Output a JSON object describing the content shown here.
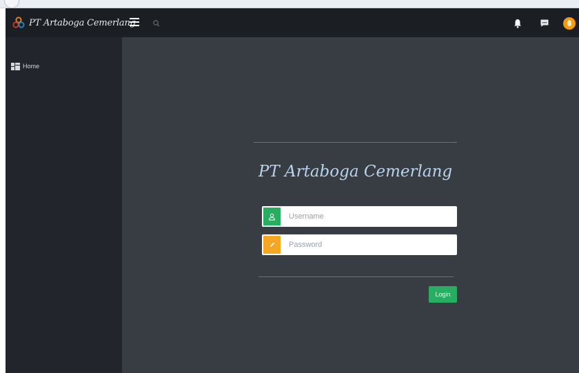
{
  "brand": {
    "name": "PT Artaboga Cemerlang",
    "logo_icon": "brand-logo-icon"
  },
  "topbar": {
    "menu_icon": "hamburger-menu-icon",
    "search_icon": "search-icon",
    "notification_icon": "bell-icon",
    "messages_icon": "chat-icon",
    "avatar_icon": "user-avatar-icon"
  },
  "sidebar": {
    "items": [
      {
        "label": "Home",
        "icon": "dashboard-grid-icon"
      }
    ]
  },
  "login": {
    "title": "PT Artaboga Cemerlang",
    "username": {
      "value": "",
      "placeholder": "Username",
      "icon": "user-icon"
    },
    "password": {
      "value": "",
      "placeholder": "Password",
      "icon": "pencil-icon"
    },
    "submit_label": "Login"
  },
  "colors": {
    "topbar": "#1b1e23",
    "sidebar": "#22262c",
    "content": "#383c43",
    "accent_green": "#27ae60",
    "accent_orange": "#f5a623",
    "title_blue": "#b9d3ee"
  }
}
